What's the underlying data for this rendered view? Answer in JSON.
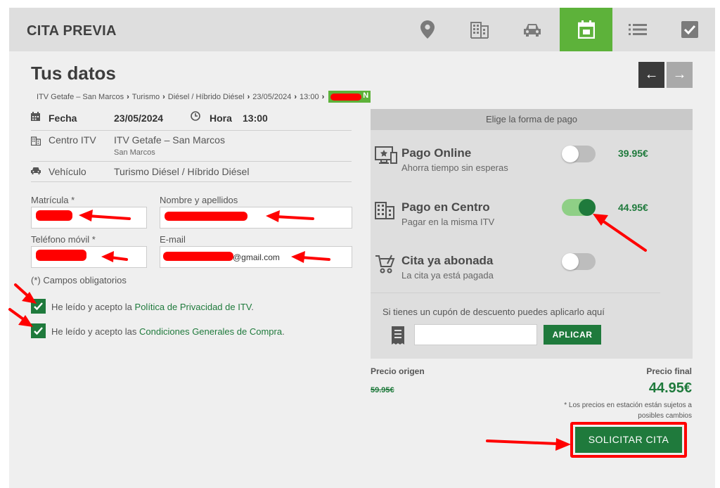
{
  "header": {
    "brand": "CITA PREVIA",
    "steps": [
      {
        "icon": "map-pin-icon",
        "active": false
      },
      {
        "icon": "building-icon",
        "active": false
      },
      {
        "icon": "car-icon",
        "active": false
      },
      {
        "icon": "calendar-icon",
        "active": true
      },
      {
        "icon": "list-icon",
        "active": false
      },
      {
        "icon": "checkbox-icon",
        "active": false
      }
    ],
    "accent": "#5db23a"
  },
  "page": {
    "title": "Tus datos",
    "breadcrumb": [
      "ITV Getafe – San Marcos",
      "Turismo",
      "Diésel / Híbrido Diésel",
      "23/05/2024",
      "13:00"
    ],
    "breadcrumb_chip_suffix": "N",
    "nav_prev": "←",
    "nav_next": "→"
  },
  "summary": {
    "fecha_label": "Fecha",
    "fecha_value": "23/05/2024",
    "hora_label": "Hora",
    "hora_value": "13:00",
    "centro_label": "Centro ITV",
    "centro_value": "ITV Getafe – San Marcos",
    "centro_sub": "San Marcos",
    "vehiculo_label": "Vehículo",
    "vehiculo_value": "Turismo Diésel / Híbrido Diésel"
  },
  "form": {
    "matricula_label": "Matrícula *",
    "nombre_label": "Nombre y apellidos",
    "telefono_label": "Teléfono móvil *",
    "email_label": "E-mail",
    "email_visible_suffix": "@gmail.com",
    "required_note": "(*) Campos obligatorios",
    "privacy_prefix": "He leído y acepto la ",
    "privacy_link": "Política de Privacidad de ITV",
    "privacy_suffix": ".",
    "terms_prefix": "He leído y acepto las ",
    "terms_link": "Condiciones Generales de Compra",
    "terms_suffix": ".",
    "privacy_checked": true,
    "terms_checked": true
  },
  "payment": {
    "header": "Elige la forma de pago",
    "options": [
      {
        "title": "Pago Online",
        "subtitle": "Ahorra tiempo sin esperas",
        "price": "39.95€",
        "selected": false,
        "icon": "online-payment-icon"
      },
      {
        "title": "Pago en Centro",
        "subtitle": "Pagar en la misma ITV",
        "price": "44.95€",
        "selected": true,
        "icon": "building-icon"
      },
      {
        "title": "Cita ya abonada",
        "subtitle": "La cita ya está pagada",
        "price": "",
        "selected": false,
        "icon": "cart-icon"
      }
    ],
    "coupon_text": "Si tienes un cupón de descuento puedes aplicarlo aquí",
    "coupon_value": "",
    "apply_label": "APLICAR"
  },
  "pricing": {
    "origin_label": "Precio origen",
    "origin_value": "59.95€",
    "final_label": "Precio final",
    "final_value": "44.95€",
    "note_line1": "* Los precios en estación están sujetos a",
    "note_line2": "posibles cambios"
  },
  "submit_label": "SOLICITAR CITA",
  "colors": {
    "green": "#1f7a3c",
    "accent_green": "#5db23a",
    "annotation_red": "#ff0000"
  }
}
